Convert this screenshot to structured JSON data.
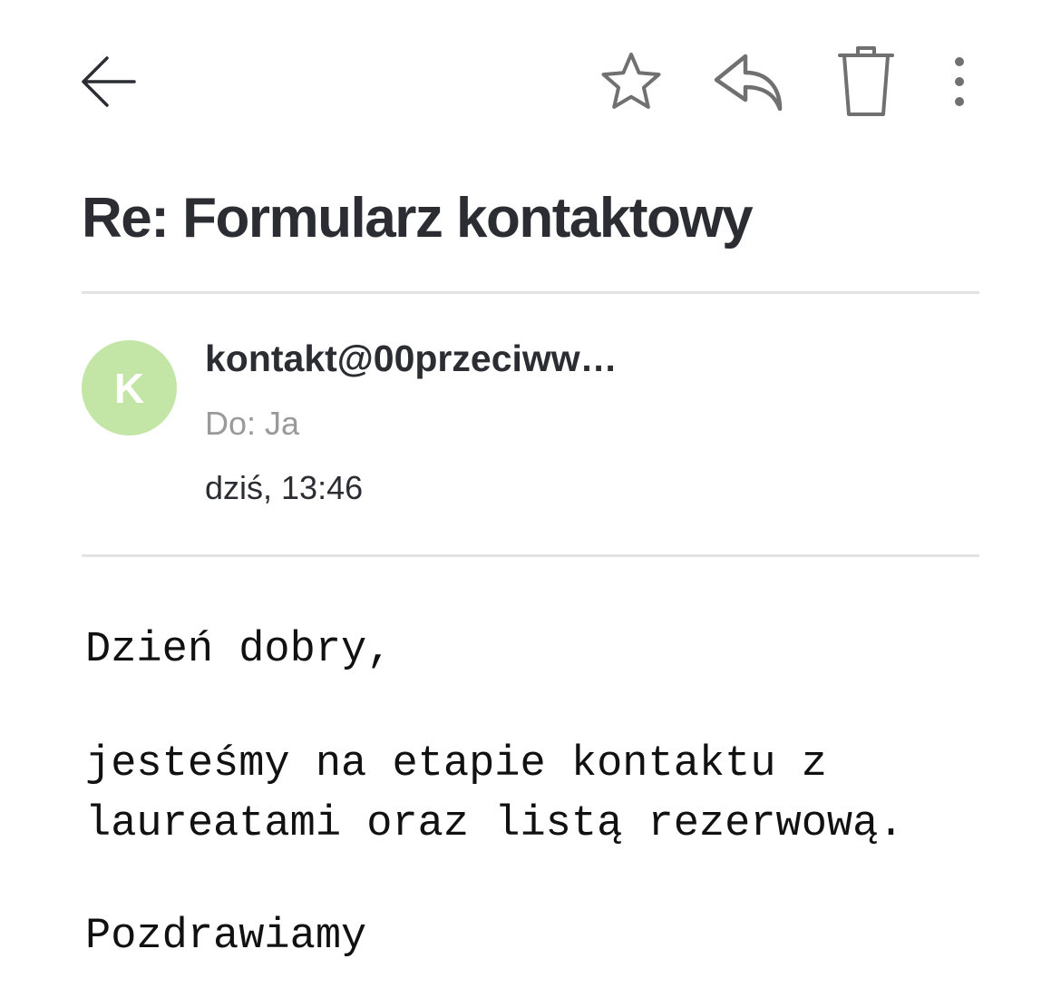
{
  "toolbar": {
    "back_icon": "arrow-left-icon",
    "star_icon": "star-icon",
    "reply_icon": "reply-icon",
    "delete_icon": "trash-icon",
    "more_icon": "more-vertical-icon",
    "icon_color": "#707070"
  },
  "message": {
    "subject": "Re: Formularz kontaktowy",
    "avatar_letter": "K",
    "avatar_color": "#c3e6a7",
    "sender": "kontakt@00przeciww…",
    "recipient": "Do: Ja",
    "datetime": "dziś, 13:46",
    "body": {
      "greeting": "Dzień dobry,",
      "paragraph_lines": [
        "jesteśmy na etapie kontaktu z",
        "laureatami oraz listą rezerwową."
      ],
      "closing": "Pozdrawiamy"
    }
  }
}
